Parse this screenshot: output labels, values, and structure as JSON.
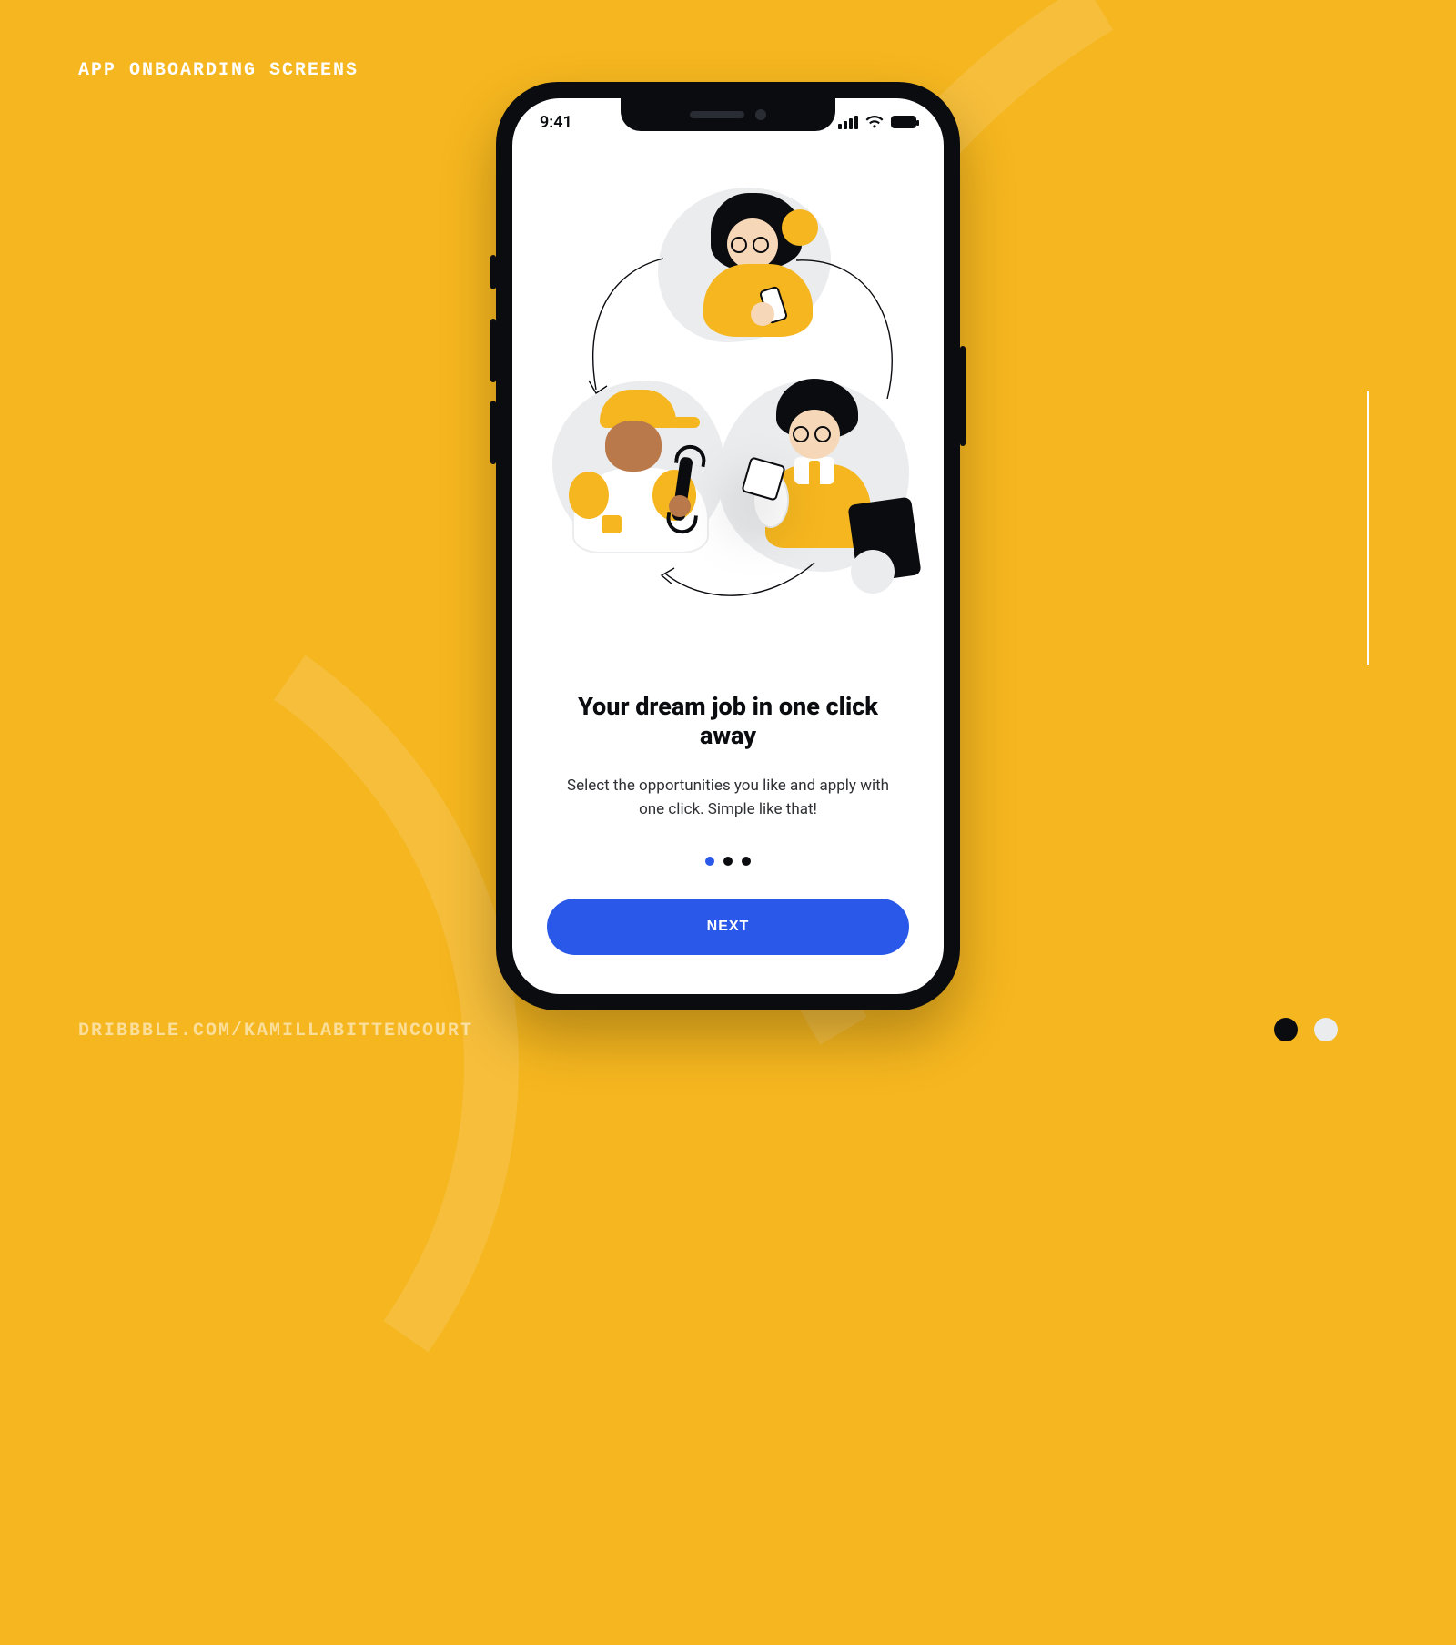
{
  "page": {
    "header_label": "APP ONBOARDING SCREENS",
    "footer_credit": "DRIBBBLE.COM/KAMILLABITTENCOURT"
  },
  "palette": {
    "dark": "#0b0c10",
    "light": "#ebecee",
    "accent": "#f5b61f"
  },
  "colors": {
    "background": "#f5b61f",
    "primary_cta": "#2a59ea",
    "dot_active": "#2a59ea",
    "dot_inactive": "#0b0c10"
  },
  "phone": {
    "status_bar": {
      "time": "9:41"
    },
    "onboarding": {
      "title": "Your dream job in one click away",
      "subtitle": "Select the opportunities you like and apply with one click. Simple like that!",
      "cta_label": "NEXT",
      "page_count": 3,
      "active_page_index": 0
    }
  }
}
